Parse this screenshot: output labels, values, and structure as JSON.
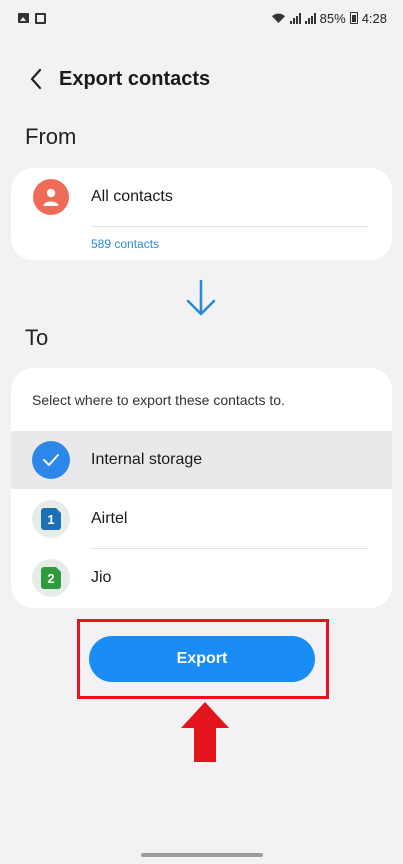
{
  "status_bar": {
    "battery": "85%",
    "time": "4:28",
    "icons": [
      "image-icon",
      "sim-card-icon",
      "wifi-icon",
      "signal-icon",
      "signal-icon",
      "battery-icon"
    ]
  },
  "header": {
    "title": "Export contacts",
    "back_icon": "chevron-left-icon"
  },
  "from": {
    "section_label": "From",
    "source_name": "All contacts",
    "source_count": "589 contacts",
    "avatar_color": "#ee6b57"
  },
  "to": {
    "section_label": "To",
    "hint": "Select where to export these contacts to.",
    "options": [
      {
        "label": "Internal storage",
        "selected": true,
        "icon": "check-icon"
      },
      {
        "label": "Airtel",
        "selected": false,
        "icon": "sim-1-icon",
        "sim_number": "1"
      },
      {
        "label": "Jio",
        "selected": false,
        "icon": "sim-2-icon",
        "sim_number": "2"
      }
    ]
  },
  "export_button": {
    "label": "Export",
    "color": "#1a8cf5"
  },
  "annotation": {
    "highlight_color": "#e4141c"
  }
}
